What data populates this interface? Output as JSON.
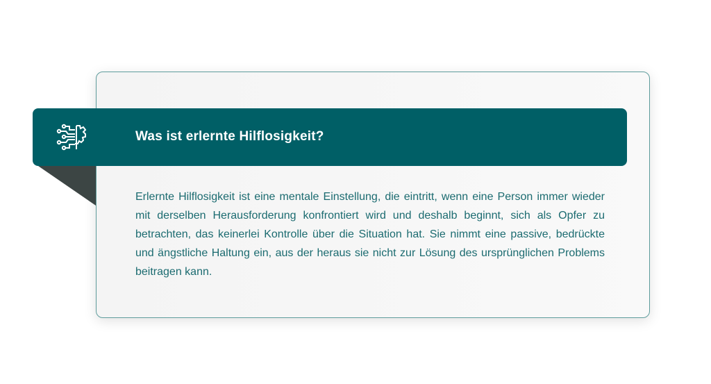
{
  "card": {
    "title": "Was ist erlernte Hilflosigkeit?",
    "icon": "circuit-gear-icon",
    "body": "Erlernte Hilflosigkeit ist eine mentale Einstellung, die eintritt, wenn eine Person immer wieder mit derselben Herausforderung konfrontiert wird und deshalb beginnt, sich als Opfer zu betrachten, das keinerlei Kontrolle über die Situation hat. Sie nimmt eine passive, bedrückte und ängstliche Haltung ein, aus der heraus sie nicht zur Lösung des ursprünglichen Problems beitragen kann."
  },
  "colors": {
    "banner": "#005f66",
    "fold": "#3c4544",
    "text": "#1b6b70",
    "border": "#5e9c9c"
  }
}
